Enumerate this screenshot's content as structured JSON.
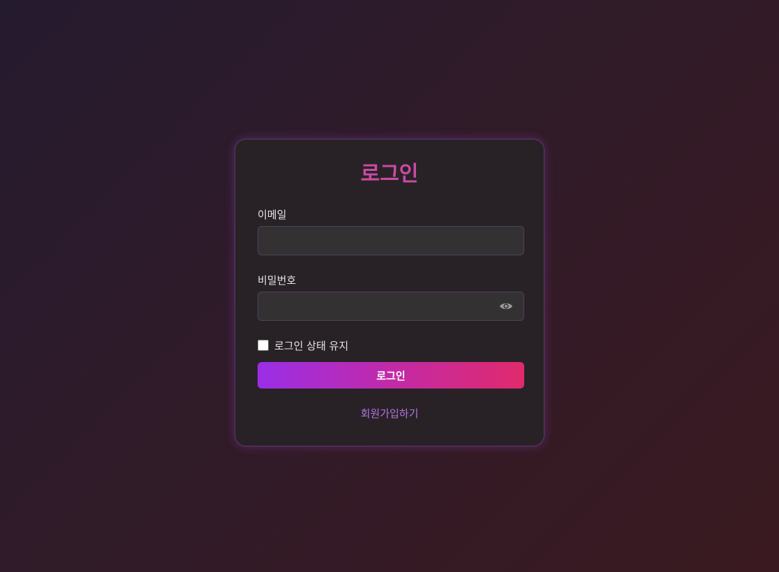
{
  "login": {
    "title": "로그인",
    "email_label": "이메일",
    "email_value": "",
    "password_label": "비밀번호",
    "password_value": "",
    "remember_label": "로그인 상태 유지",
    "remember_checked": false,
    "submit_label": "로그인",
    "signup_link": "회원가입하기"
  },
  "icons": {
    "password_toggle": "eye-icon"
  },
  "colors": {
    "title": "#c94aa6",
    "button_gradient_start": "#9a2ee6",
    "button_gradient_end": "#e02a6c",
    "link": "#b674e0",
    "card_background": "#282226"
  }
}
